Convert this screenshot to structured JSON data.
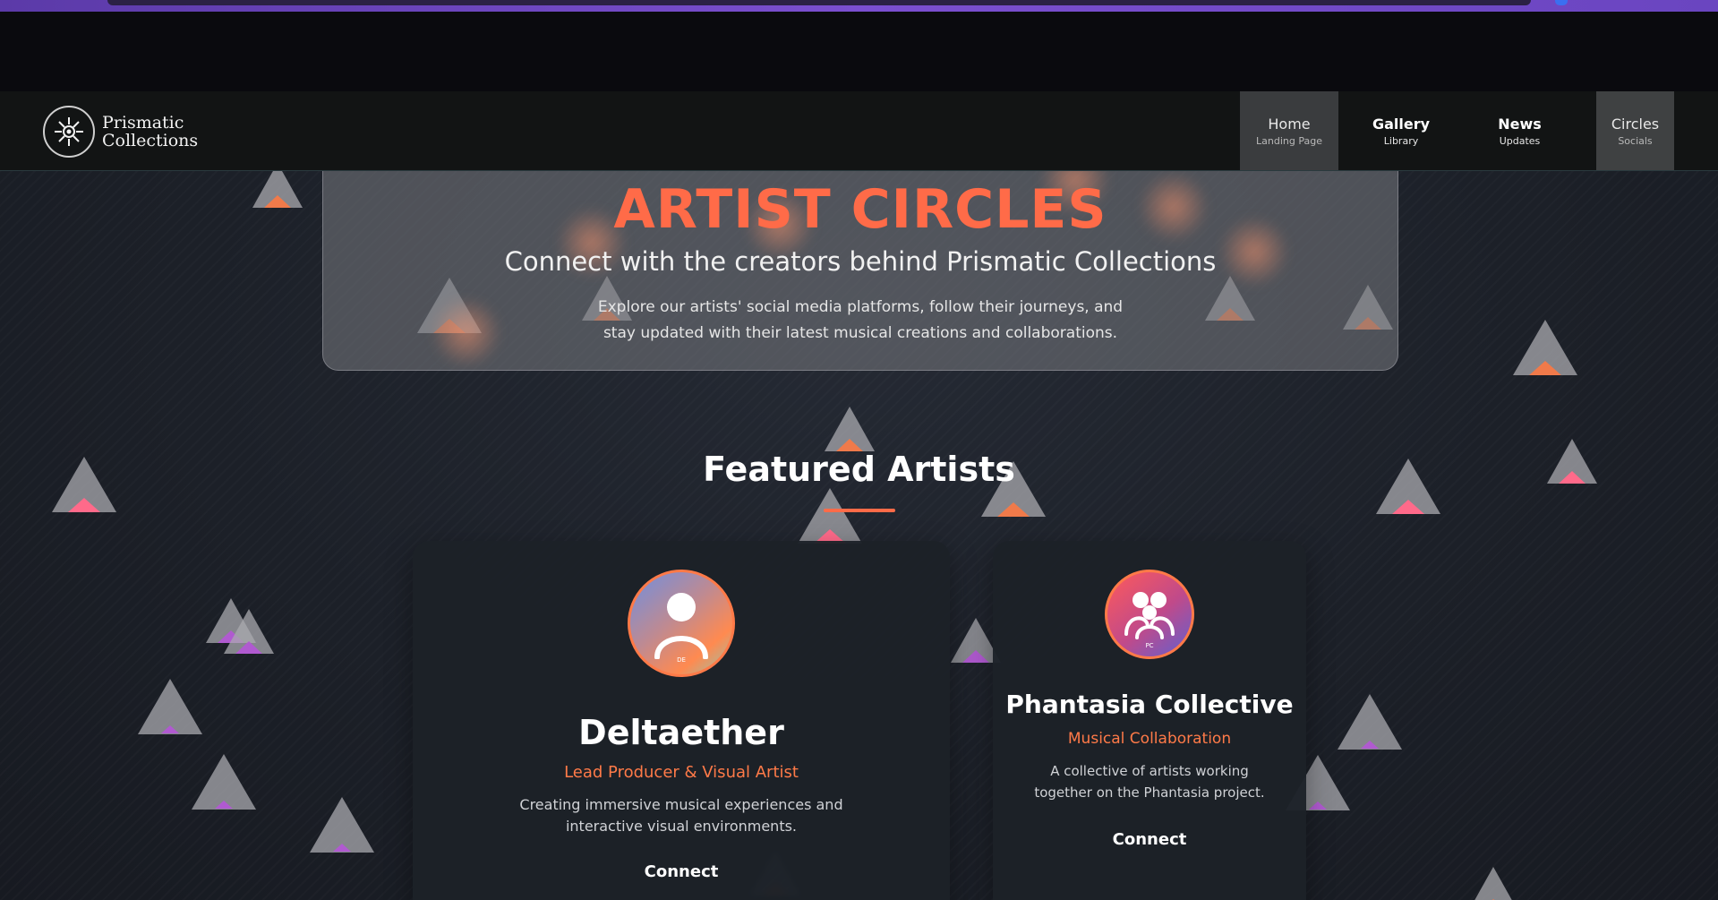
{
  "brand": {
    "line1": "Prismatic",
    "line2": "Collections"
  },
  "nav": [
    {
      "title": "Home",
      "sub": "Landing Page"
    },
    {
      "title": "Gallery",
      "sub": "Library"
    },
    {
      "title": "News",
      "sub": "Updates"
    },
    {
      "title": "Circles",
      "sub": "Socials"
    }
  ],
  "hero": {
    "title": "ARTIST CIRCLES",
    "subtitle": "Connect with the creators behind Prismatic Collections",
    "description": "Explore our artists' social media platforms, follow their journeys, and stay updated with their latest musical creations and collaborations."
  },
  "featured": {
    "title": "Featured Artists"
  },
  "artists": [
    {
      "initials": "DE",
      "name": "Deltaether",
      "role": "Lead Producer & Visual Artist",
      "description": "Creating immersive musical experiences and interactive visual environments.",
      "connect_label": "Connect"
    },
    {
      "initials": "PC",
      "name": "Phantasia Collective",
      "role": "Musical Collaboration",
      "description": "A collective of artists working together on the Phantasia project.",
      "connect_label": "Connect"
    }
  ],
  "colors": {
    "accent": "#ff6b48",
    "background": "#1c2028",
    "navbar": "#121414"
  }
}
